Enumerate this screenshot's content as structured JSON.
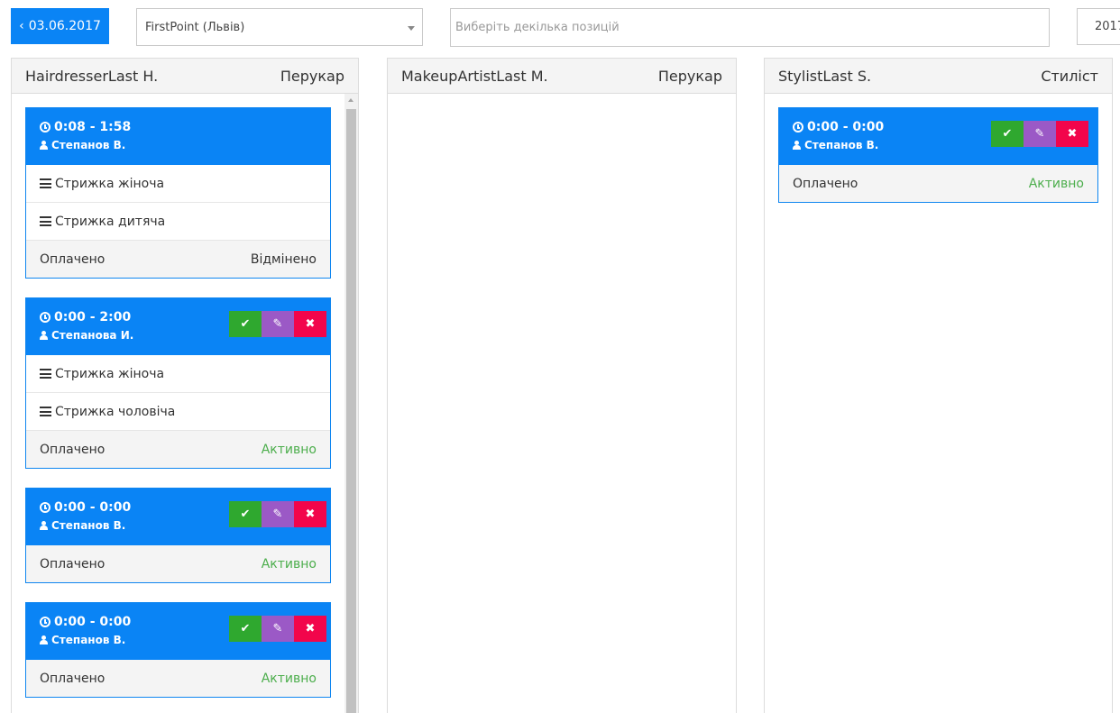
{
  "toolbar": {
    "date": "03.06.2017",
    "location_select": "FirstPoint (Львів)",
    "positions_placeholder": "Виберіть декілька позицій",
    "year_partial": "2017"
  },
  "colors": {
    "primary": "#0a84f5",
    "confirm": "#2fa82f",
    "edit": "#9b59c6",
    "delete": "#f2054b",
    "active_status": "#4cae4c"
  },
  "columns": [
    {
      "name": "HairdresserLast H.",
      "role": "Перукар",
      "cards": [
        {
          "time": "0:08 - 1:58",
          "client": "Степанов В.",
          "services": [
            "Стрижка жіноча",
            "Стрижка дитяча"
          ],
          "payment": "Оплачено",
          "status": "Відмінено"
        },
        {
          "time": "0:00 - 2:00",
          "client": "Степанова И.",
          "services": [
            "Стрижка жіноча",
            "Стрижка чоловіча"
          ],
          "payment": "Оплачено",
          "status": "Активно"
        },
        {
          "time": "0:00 - 0:00",
          "client": "Степанов В.",
          "services": [],
          "payment": "Оплачено",
          "status": "Активно"
        },
        {
          "time": "0:00 - 0:00",
          "client": "Степанов В.",
          "services": [],
          "payment": "Оплачено",
          "status": "Активно"
        }
      ]
    },
    {
      "name": "MakeupArtistLast M.",
      "role": "Перукар",
      "cards": []
    },
    {
      "name": "StylistLast S.",
      "role": "Стиліст",
      "cards": [
        {
          "time": "0:00 - 0:00",
          "client": "Степанов В.",
          "services": [],
          "payment": "Оплачено",
          "status": "Активно"
        }
      ]
    }
  ],
  "icons": {
    "back": "chevron-left-icon",
    "clock": "clock-icon",
    "user": "user-icon",
    "service": "list-icon",
    "confirm": "check-icon",
    "edit": "pencil-icon",
    "delete": "close-icon"
  }
}
